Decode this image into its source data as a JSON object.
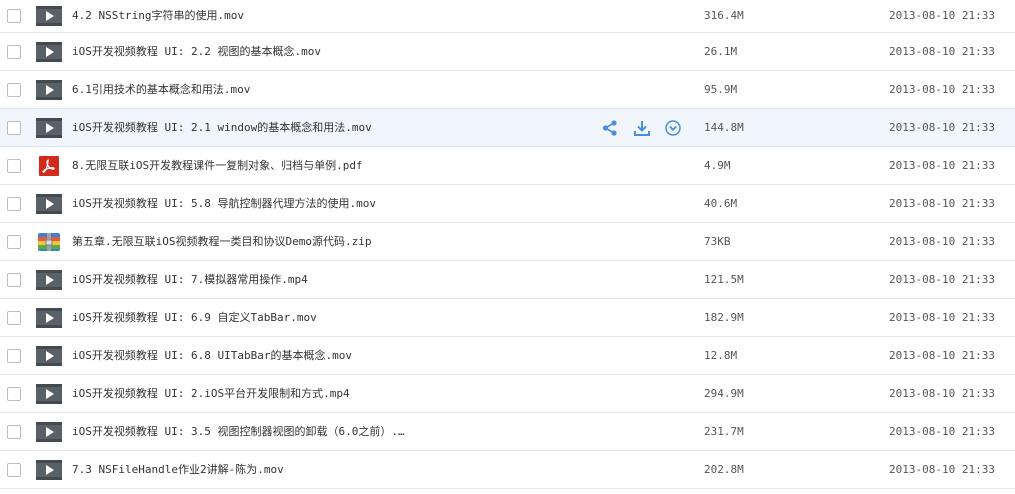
{
  "files": [
    {
      "name": "4.2 NSString字符串的使用.mov",
      "size": "316.4M",
      "time": "2013-08-10 21:33",
      "type": "video"
    },
    {
      "name": "iOS开发视频教程 UI: 2.2 视图的基本概念.mov",
      "size": "26.1M",
      "time": "2013-08-10 21:33",
      "type": "video"
    },
    {
      "name": "6.1引用技术的基本概念和用法.mov",
      "size": "95.9M",
      "time": "2013-08-10 21:33",
      "type": "video"
    },
    {
      "name": "iOS开发视频教程 UI: 2.1 window的基本概念和用法.mov",
      "size": "144.8M",
      "time": "2013-08-10 21:33",
      "type": "video"
    },
    {
      "name": "8.无限互联iOS开发教程课件一复制对象、归档与单例.pdf",
      "size": "4.9M",
      "time": "2013-08-10 21:33",
      "type": "pdf"
    },
    {
      "name": "iOS开发视频教程 UI: 5.8 导航控制器代理方法的使用.mov",
      "size": "40.6M",
      "time": "2013-08-10 21:33",
      "type": "video"
    },
    {
      "name": "第五章.无限互联iOS视频教程一类目和协议Demo源代码.zip",
      "size": "73KB",
      "time": "2013-08-10 21:33",
      "type": "zip"
    },
    {
      "name": "iOS开发视频教程 UI: 7.模拟器常用操作.mp4",
      "size": "121.5M",
      "time": "2013-08-10 21:33",
      "type": "video"
    },
    {
      "name": "iOS开发视频教程 UI: 6.9 自定义TabBar.mov",
      "size": "182.9M",
      "time": "2013-08-10 21:33",
      "type": "video"
    },
    {
      "name": "iOS开发视频教程 UI: 6.8 UITabBar的基本概念.mov",
      "size": "12.8M",
      "time": "2013-08-10 21:33",
      "type": "video"
    },
    {
      "name": "iOS开发视频教程 UI: 2.iOS平台开发限制和方式.mp4",
      "size": "294.9M",
      "time": "2013-08-10 21:33",
      "type": "video"
    },
    {
      "name": "iOS开发视频教程 UI: 3.5 视图控制器视图的卸载（6.0之前）.…",
      "size": "231.7M",
      "time": "2013-08-10 21:33",
      "type": "video"
    },
    {
      "name": "7.3 NSFileHandle作业2讲解-陈为.mov",
      "size": "202.8M",
      "time": "2013-08-10 21:33",
      "type": "video"
    }
  ],
  "hover_actions": [
    "share-icon",
    "download-icon",
    "more-icon"
  ],
  "colors": {
    "action_icon": "#4a90d9",
    "hover_row": "#f1f6fc",
    "pdf_red": "#d42a1c"
  }
}
